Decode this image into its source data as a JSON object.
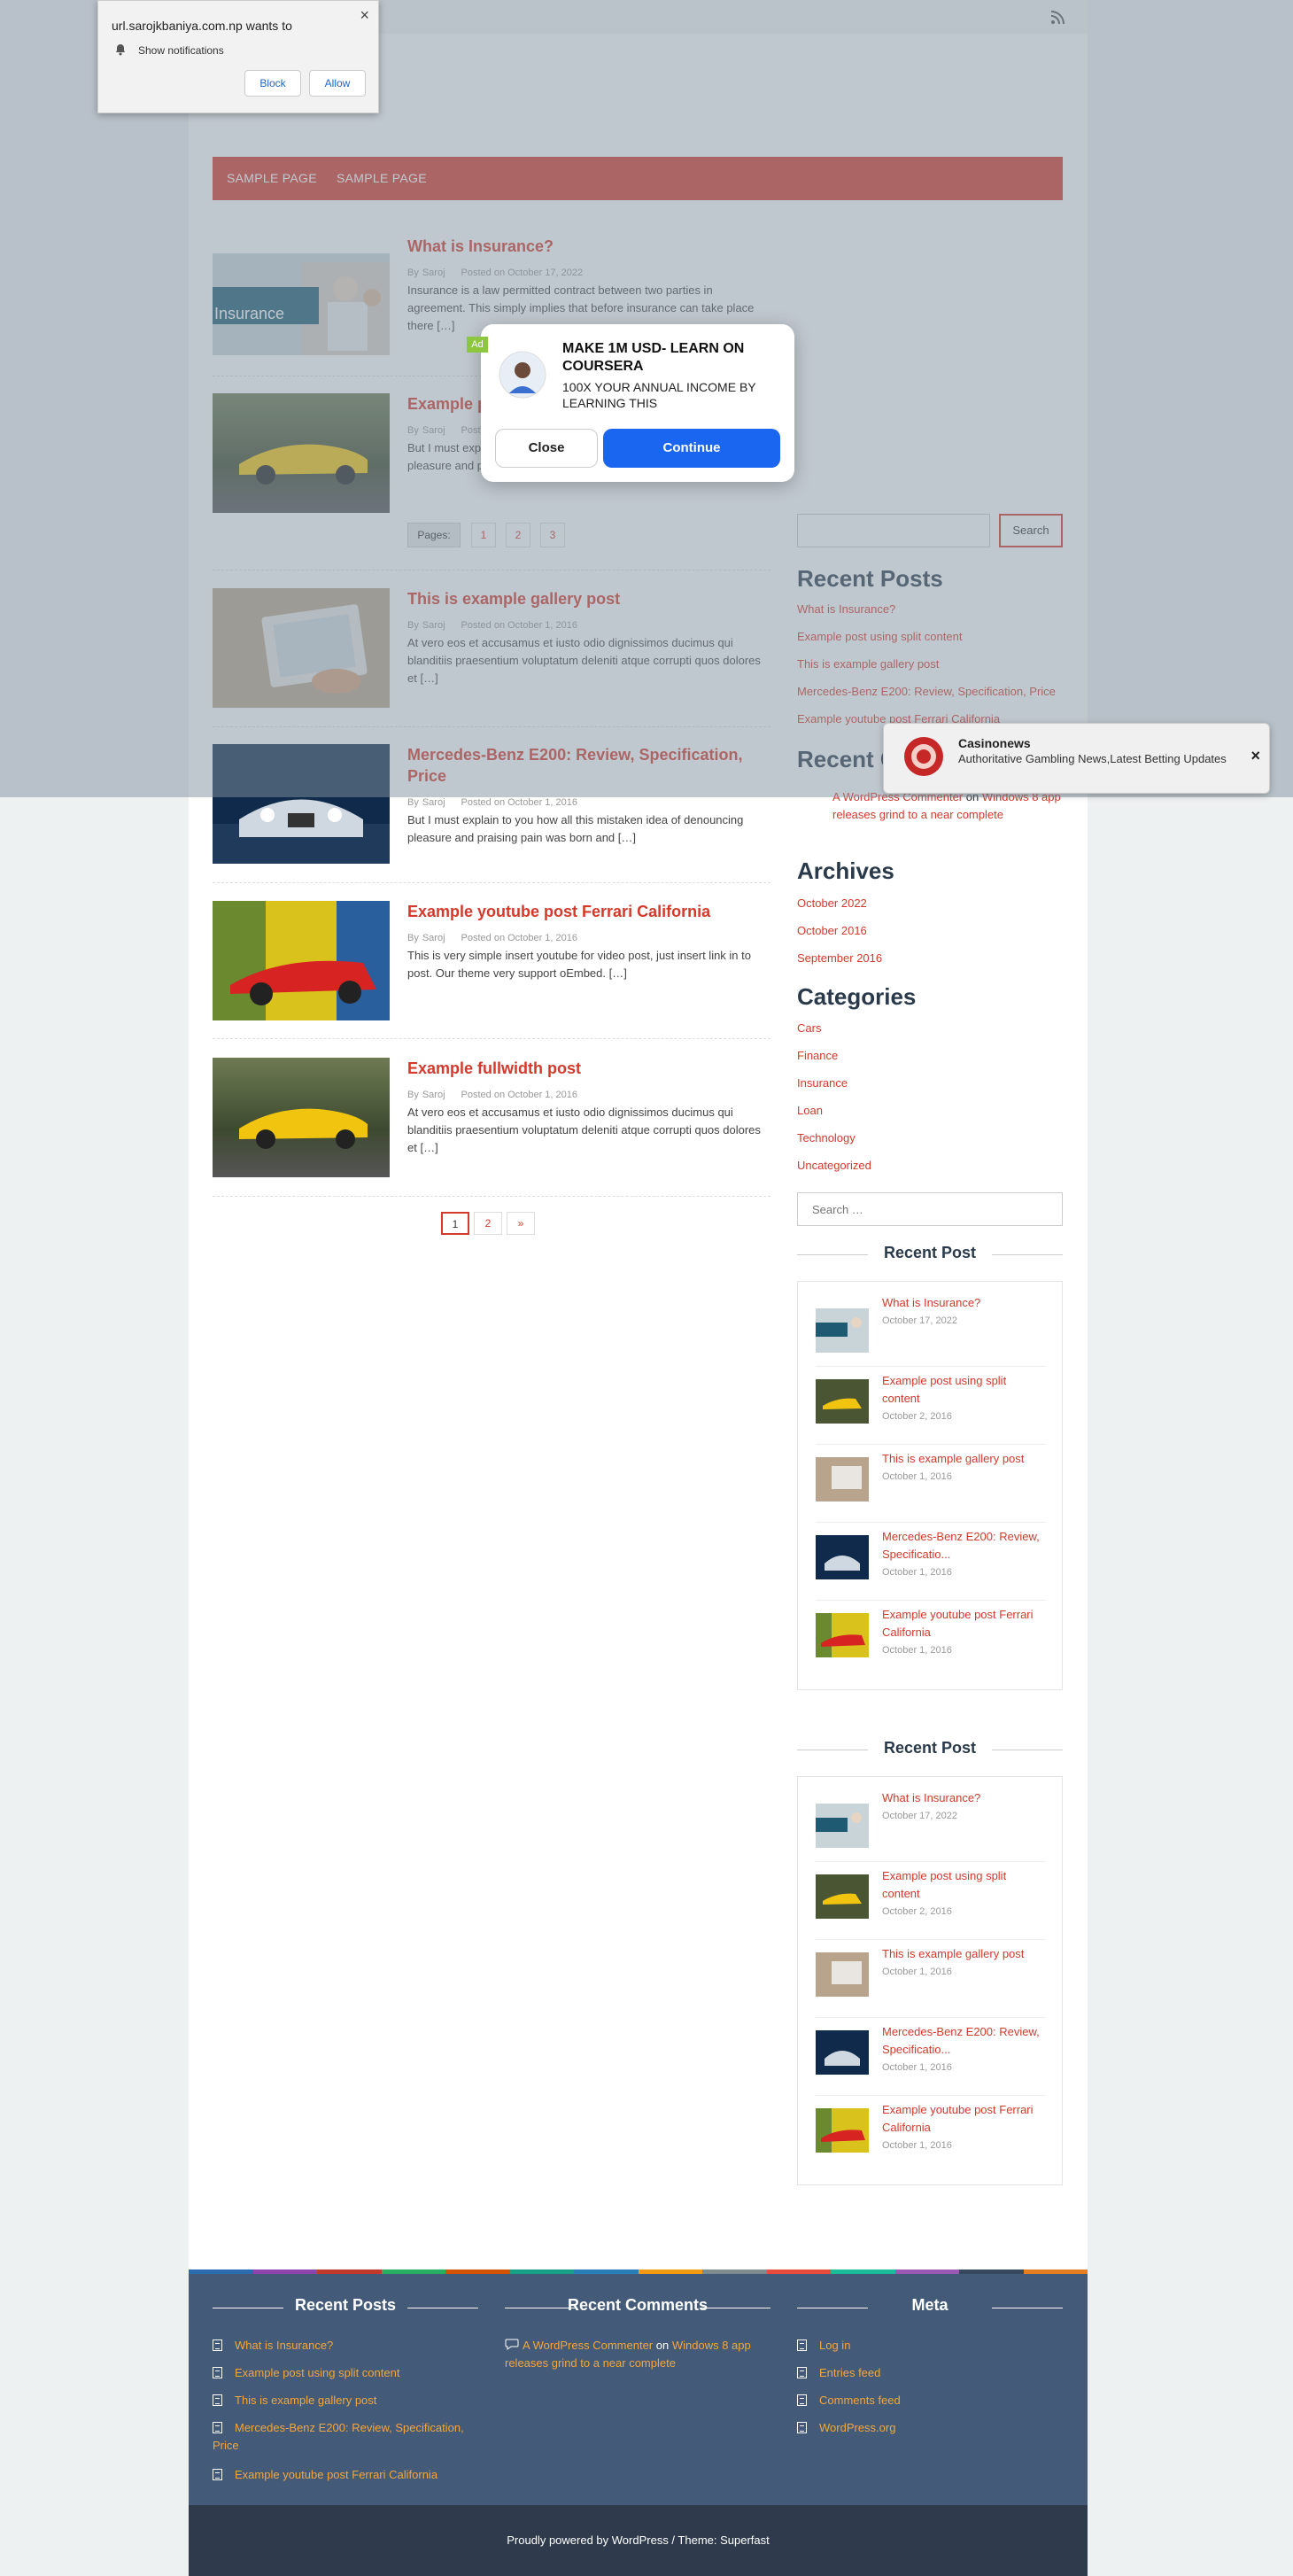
{
  "nav": {
    "items": [
      "SAMPLE PAGE",
      "SAMPLE PAGE"
    ]
  },
  "posts": [
    {
      "title": "What is Insurance?",
      "author_prefix": "By",
      "author": "Saroj",
      "date": "Posted on October 17, 2022",
      "excerpt": "Insurance is a law permitted contract between two parties in agreement. This simply implies that before insurance can take place there […]",
      "thumb_label": "Insurance"
    },
    {
      "title": "Example post using split content",
      "author_prefix": "By",
      "author": "Saroj",
      "date": "Posted on October 2, 2016",
      "excerpt": "But I must explain to you how all this mistaken idea of denouncing pleasure and praising pain was born and […]"
    },
    {
      "title": "This is example gallery post",
      "author_prefix": "By",
      "author": "Saroj",
      "date": "Posted on October 1, 2016",
      "excerpt": "At vero eos et accusamus et iusto odio dignissimos ducimus qui blanditiis praesentium voluptatum deleniti atque corrupti quos dolores et […]"
    },
    {
      "title": "Mercedes-Benz E200: Review, Specification, Price",
      "author_prefix": "By",
      "author": "Saroj",
      "date": "Posted on October 1, 2016",
      "excerpt": "But I must explain to you how all this mistaken idea of denouncing pleasure and praising pain was born and […]"
    },
    {
      "title": "Example youtube post Ferrari California",
      "author_prefix": "By",
      "author": "Saroj",
      "date": "Posted on October 1, 2016",
      "excerpt": "This is very simple insert youtube for video post, just insert link in to post. Our theme very support oEmbed. […]"
    },
    {
      "title": "Example fullwidth post",
      "author_prefix": "By",
      "author": "Saroj",
      "date": "Posted on October 1, 2016",
      "excerpt": "At vero eos et accusamus et iusto odio dignissimos ducimus qui blanditiis praesentium voluptatum deleniti atque corrupti quos dolores et […]"
    }
  ],
  "post_pages": {
    "label": "Pages:",
    "pages": [
      "1",
      "2",
      "3"
    ]
  },
  "pagination": [
    "1",
    "2",
    "»"
  ],
  "sidebar": {
    "search_button": "Search",
    "recent_posts_heading": "Recent Posts",
    "recent_posts": [
      "What is Insurance?",
      "Example post using split content",
      "This is example gallery post",
      "Mercedes-Benz E200: Review, Specification, Price",
      "Example youtube post Ferrari California"
    ],
    "recent_comments_heading": "Recent Comments",
    "recent_comment": {
      "author": "A WordPress Commenter",
      "on": "on",
      "post": "Windows 8 app releases grind to a near complete"
    },
    "archives_heading": "Archives",
    "archives": [
      "October 2022",
      "October 2016",
      "September 2016"
    ],
    "categories_heading": "Categories",
    "categories": [
      "Cars",
      "Finance",
      "Insurance",
      "Loan",
      "Technology",
      "Uncategorized"
    ],
    "search_placeholder": "Search …",
    "recent_post_heading": "Recent Post",
    "recent_post_items": [
      {
        "title": "What is Insurance?",
        "date": "October 17, 2022"
      },
      {
        "title": "Example post using split content",
        "date": "October 2, 2016"
      },
      {
        "title": "This is example gallery post",
        "date": "October 1, 2016"
      },
      {
        "title": "Mercedes-Benz E200: Review, Specificatio...",
        "date": "October 1, 2016"
      },
      {
        "title": "Example youtube post Ferrari California",
        "date": "October 1, 2016"
      }
    ]
  },
  "footer": {
    "recent_posts_heading": "Recent Posts",
    "recent_posts": [
      "What is Insurance?",
      "Example post using split content",
      "This is example gallery post",
      "Mercedes-Benz E200: Review, Specification, Price",
      "Example youtube post Ferrari California"
    ],
    "recent_comments_heading": "Recent Comments",
    "comment_author": "A WordPress Commenter",
    "comment_on": "on",
    "comment_post": "Windows 8 app releases grind to a near complete",
    "meta_heading": "Meta",
    "meta": [
      "Log in",
      "Entries feed",
      "Comments feed",
      "WordPress.org"
    ],
    "credit": "Proudly powered by WordPress / Theme: Superfast"
  },
  "notification": {
    "text": "url.sarojkbaniya.com.np wants to",
    "option": "Show notifications",
    "block": "Block",
    "allow": "Allow",
    "close": "×"
  },
  "ad": {
    "badge": "Ad",
    "title": "MAKE 1M USD- LEARN ON COURSERA",
    "body": "100X YOUR ANNUAL INCOME BY LEARNING THIS",
    "close_button": "Close",
    "continue_button": "Continue"
  },
  "toast": {
    "title": "Casinonews",
    "body": "Authoritative Gambling News,Latest Betting Updates",
    "close": "×"
  },
  "colors": {
    "accent": "#d4392b",
    "footer": "#435b78",
    "footer_bottom": "#2f3b4c",
    "link_footer": "#f3a63b",
    "ad_button": "#1a66f0"
  }
}
